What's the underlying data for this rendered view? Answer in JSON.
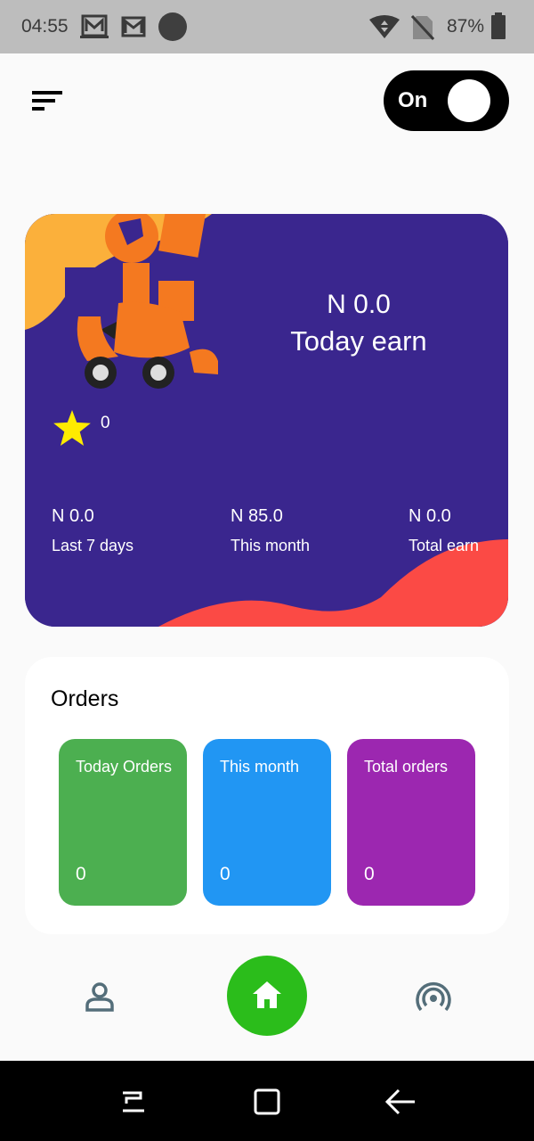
{
  "status_bar": {
    "time": "04:55",
    "battery": "87%"
  },
  "header": {
    "toggle_label": "On"
  },
  "earnings": {
    "today_amount": "N 0.0",
    "today_label": "Today earn",
    "rating": "0",
    "stats": [
      {
        "value": "N 0.0",
        "label": "Last 7 days"
      },
      {
        "value": "N 85.0",
        "label": "This month"
      },
      {
        "value": "N 0.0",
        "label": "Total earn"
      }
    ]
  },
  "orders": {
    "title": "Orders",
    "tiles": [
      {
        "label": "Today Orders",
        "value": "0",
        "color": "#4caf50"
      },
      {
        "label": "This month",
        "value": "0",
        "color": "#2196f3"
      },
      {
        "label": "Total orders",
        "value": "0",
        "color": "#9c27b0"
      }
    ]
  },
  "bottom_nav": {
    "items": [
      "profile-icon",
      "home-icon",
      "broadcast-icon"
    ],
    "active_color": "#2bbd1b"
  }
}
